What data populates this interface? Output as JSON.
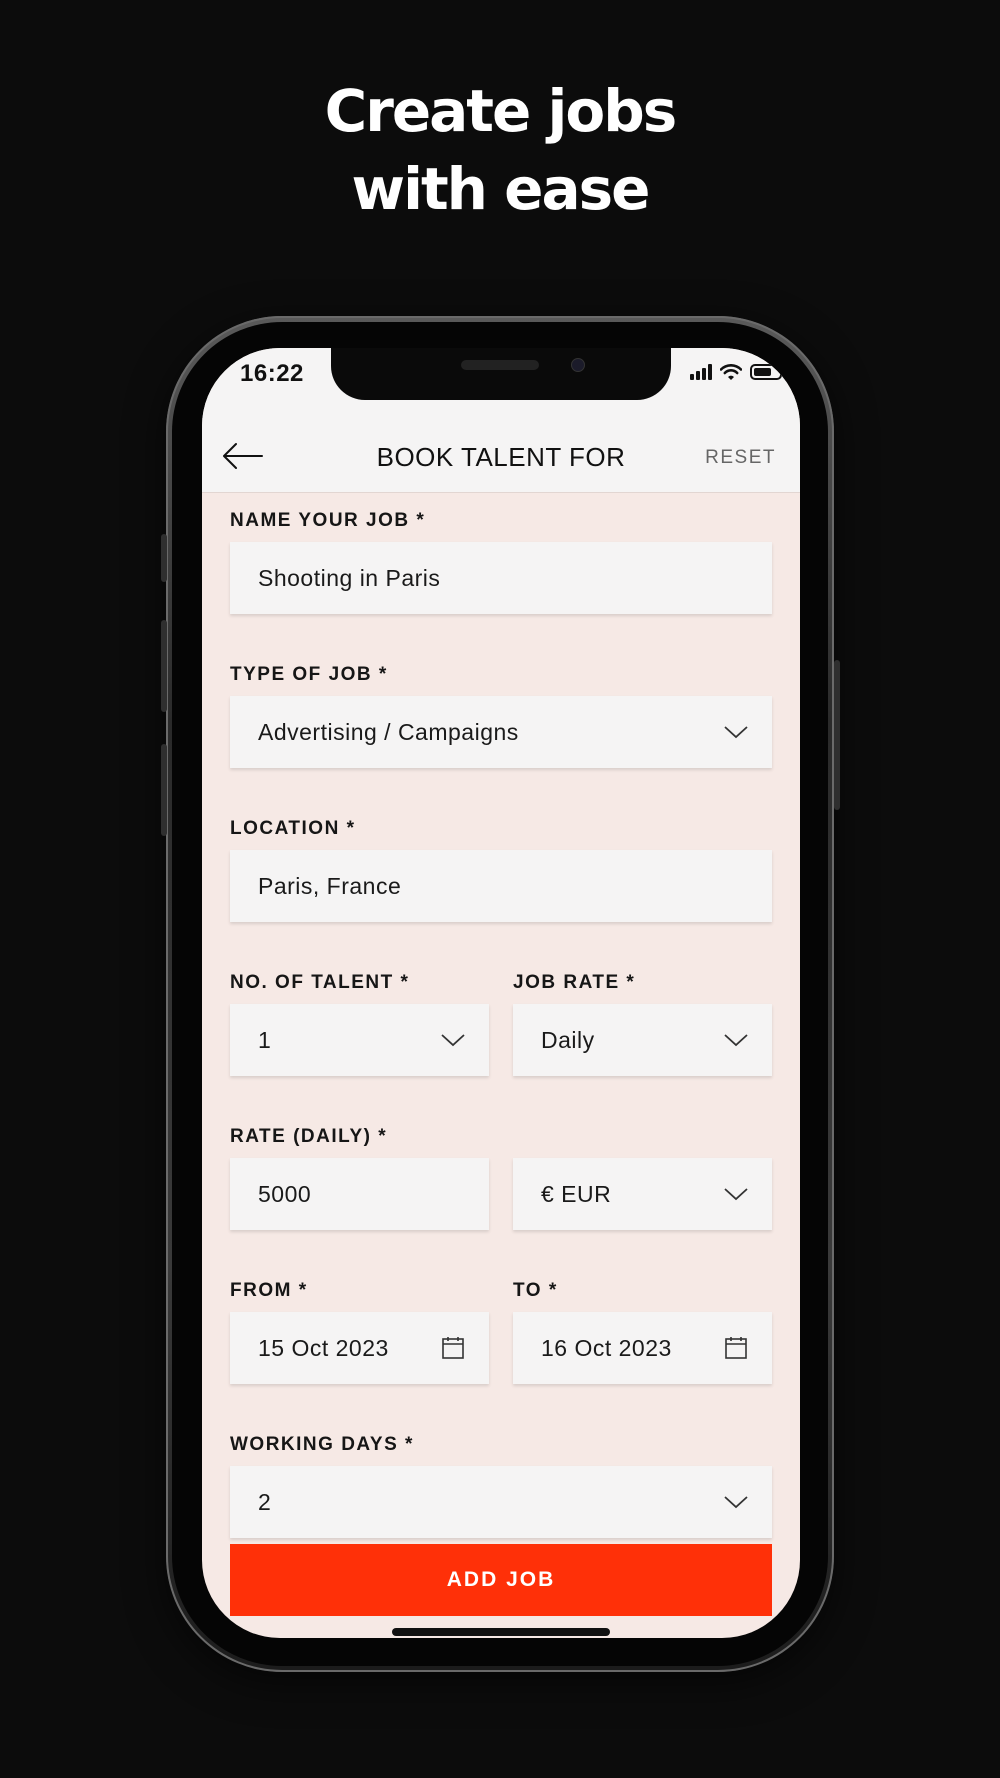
{
  "headline": {
    "line1": "Create jobs",
    "line2": "with ease"
  },
  "status_bar": {
    "time": "16:22"
  },
  "navbar": {
    "title": "BOOK TALENT FOR",
    "reset_label": "RESET"
  },
  "form": {
    "job_name": {
      "label": "NAME YOUR JOB *",
      "value": "Shooting in Paris"
    },
    "job_type": {
      "label": "TYPE OF JOB *",
      "value": "Advertising / Campaigns"
    },
    "location": {
      "label": "LOCATION *",
      "value": "Paris, France"
    },
    "talent_count": {
      "label": "NO. OF TALENT *",
      "value": "1"
    },
    "job_rate": {
      "label": "JOB RATE *",
      "value": "Daily"
    },
    "rate": {
      "label": "RATE (DAILY) *",
      "value": "5000"
    },
    "currency": {
      "value": "€ EUR"
    },
    "from": {
      "label": "FROM *",
      "value": "15 Oct 2023"
    },
    "to": {
      "label": "TO *",
      "value": "16 Oct 2023"
    },
    "working_days": {
      "label": "WORKING DAYS *",
      "value": "2"
    }
  },
  "add_button_label": "ADD JOB",
  "colors": {
    "accent": "#ff3008",
    "form_background": "#f6e9e5",
    "field_background": "#f5f4f4",
    "page_background": "#0c0c0c"
  },
  "icons": {
    "back": "arrow-left-icon",
    "dropdown": "chevron-down-icon",
    "calendar": "calendar-icon"
  }
}
